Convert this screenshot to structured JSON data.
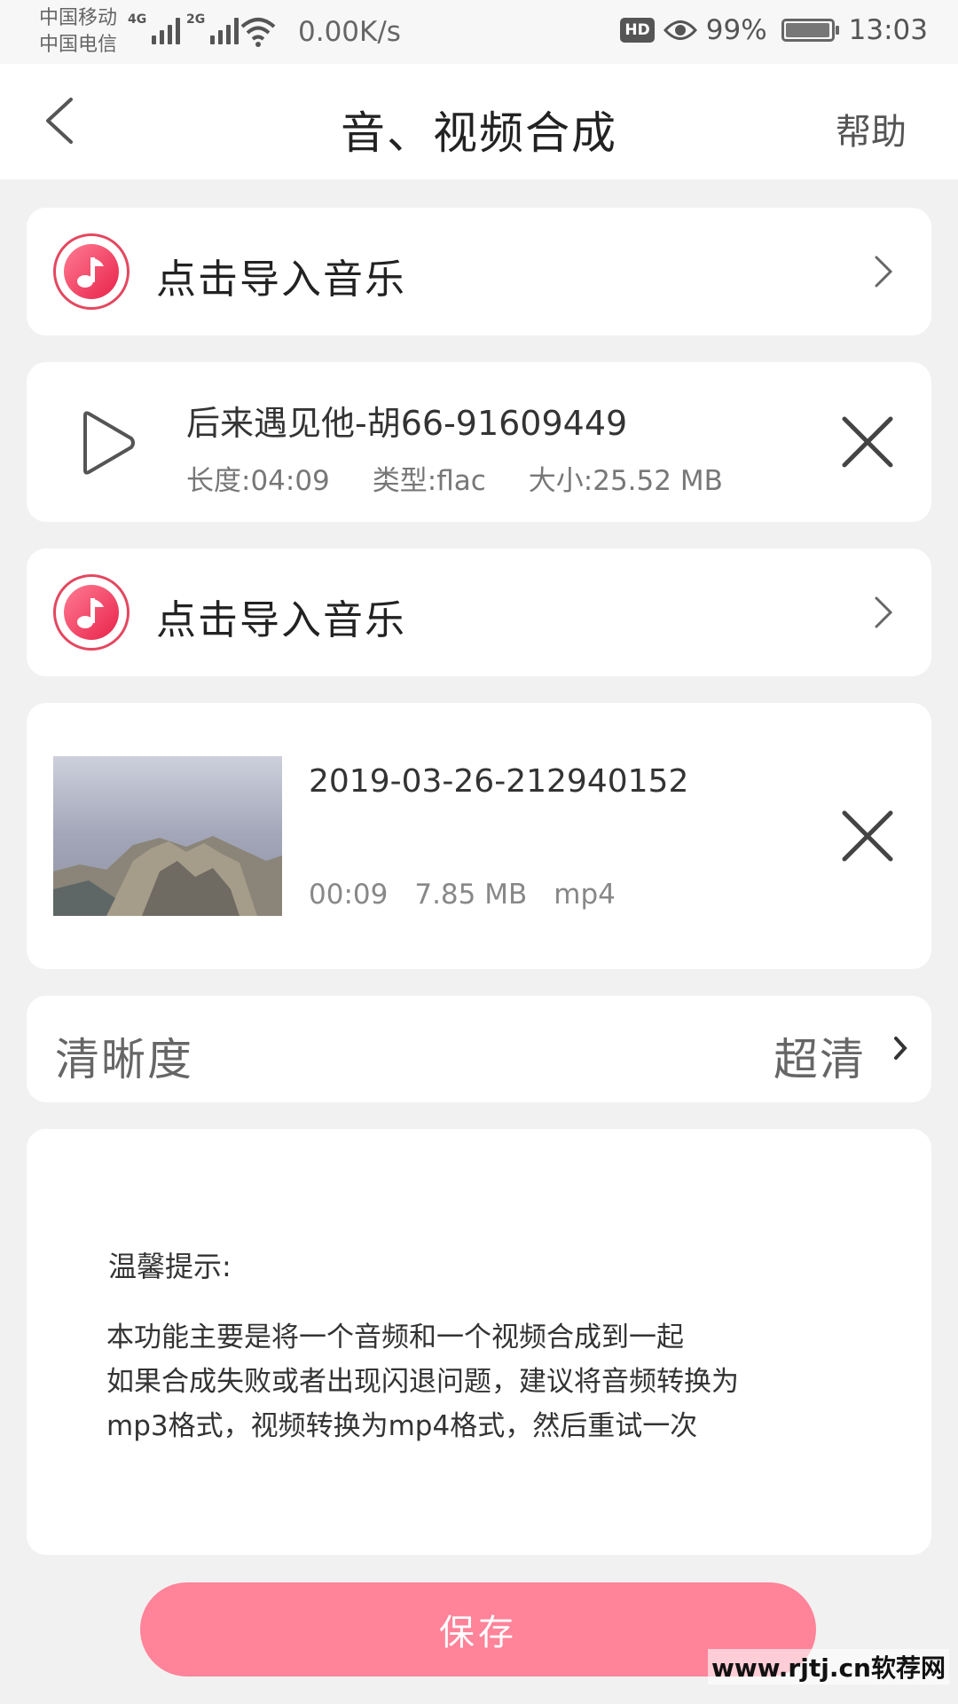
{
  "status_bar": {
    "carrier1": "中国移动",
    "carrier2": "中国电信",
    "sig1_tag": "4G",
    "sig2_tag": "2G",
    "net_speed": "0.00K/s",
    "hd": "HD",
    "battery_pct": "99%",
    "time": "13:03"
  },
  "header": {
    "title": "音、视频合成",
    "help": "帮助"
  },
  "import_music": {
    "label": "点击导入音乐"
  },
  "audio_item": {
    "title": "后来遇见他-胡66-91609449",
    "length": "长度:04:09",
    "type": "类型:flac",
    "size": "大小:25.52 MB"
  },
  "video_item": {
    "name": "2019-03-26-212940152",
    "duration": "00:09",
    "size": "7.85 MB",
    "format": "mp4"
  },
  "clarity": {
    "label": "清晰度",
    "value": "超清"
  },
  "tips": {
    "title": "温馨提示:",
    "body": " 本功能主要是将一个音频和一个视频合成到一起\n 如果合成失败或者出现闪退问题，建议将音频转换为\nmp3格式，视频转换为mp4格式，然后重试一次"
  },
  "save_label": "保存",
  "watermark": "www.rjtj.cn软荐网",
  "colors": {
    "accent": "#ff8399",
    "music_icon": "#e8224a",
    "background": "#f1f1f1"
  }
}
